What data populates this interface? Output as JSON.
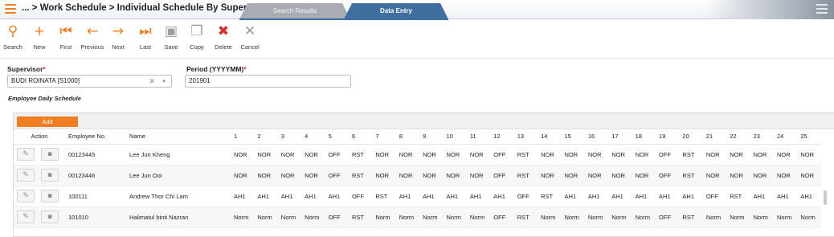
{
  "header": {
    "breadcrumb": "... > Work Schedule > Individual Schedule By Supervisor",
    "tabs": [
      {
        "label": "Search Results"
      },
      {
        "label": "Data Entry"
      }
    ]
  },
  "toolbar": [
    {
      "key": "search",
      "label": "Search",
      "glyph": "⚲",
      "icon": "search-icon",
      "tone": "orange"
    },
    {
      "key": "new",
      "label": "New",
      "glyph": "+",
      "icon": "plus-icon",
      "tone": "orange"
    },
    {
      "key": "first",
      "label": "First",
      "glyph": "⏮",
      "icon": "first-record-icon",
      "tone": "orange"
    },
    {
      "key": "previous",
      "label": "Previous",
      "glyph": "←",
      "icon": "arrow-left-icon",
      "tone": "orange"
    },
    {
      "key": "next",
      "label": "Next",
      "glyph": "→",
      "icon": "arrow-right-icon",
      "tone": "orange"
    },
    {
      "key": "last",
      "label": "Last",
      "glyph": "⏭",
      "icon": "last-record-icon",
      "tone": "orange"
    },
    {
      "key": "save",
      "label": "Save",
      "glyph": "▣",
      "icon": "save-icon",
      "tone": "gray"
    },
    {
      "key": "copy",
      "label": "Copy",
      "glyph": "❐",
      "icon": "copy-icon",
      "tone": "gray"
    },
    {
      "key": "delete",
      "label": "Delete",
      "glyph": "✖",
      "icon": "delete-icon",
      "tone": "red"
    },
    {
      "key": "cancel",
      "label": "Cancel",
      "glyph": "✕",
      "icon": "cancel-icon",
      "tone": "gray"
    }
  ],
  "form": {
    "supervisor": {
      "label": "Supervisor",
      "required_mark": "*",
      "value": "BUDI ROINATA [S1000]"
    },
    "period": {
      "label": "Period (YYYYMM)",
      "required_mark": "*",
      "value": "201901"
    }
  },
  "section_title": "Employee Daily Schedule",
  "grid": {
    "add_label": "Add",
    "columns": {
      "action": "Action",
      "employee_no": "Employee No.",
      "name": "Name",
      "days": [
        "1",
        "2",
        "3",
        "4",
        "5",
        "6",
        "7",
        "8",
        "9",
        "10",
        "11",
        "12",
        "13",
        "14",
        "15",
        "16",
        "17",
        "18",
        "19",
        "20",
        "21",
        "22",
        "23",
        "24",
        "25"
      ]
    },
    "rows": [
      {
        "employee_no": "00123445",
        "name": "Lee Jun Kheng",
        "days": [
          "NOR",
          "NOR",
          "NOR",
          "NOR",
          "OFF",
          "RST",
          "NOR",
          "NOR",
          "NOR",
          "NOR",
          "NOR",
          "OFF",
          "RST",
          "NOR",
          "NOR",
          "NOR",
          "NOR",
          "NOR",
          "OFF",
          "RST",
          "NOR",
          "NOR",
          "NOR",
          "NOR",
          "NOR"
        ]
      },
      {
        "employee_no": "00123446",
        "name": "Lee Jun Ooi",
        "days": [
          "NOR",
          "NOR",
          "NOR",
          "NOR",
          "OFF",
          "RST",
          "NOR",
          "NOR",
          "NOR",
          "NOR",
          "NOR",
          "OFF",
          "RST",
          "NOR",
          "NOR",
          "NOR",
          "NOR",
          "NOR",
          "OFF",
          "RST",
          "NOR",
          "NOR",
          "NOR",
          "NOR",
          "NOR"
        ]
      },
      {
        "employee_no": "100111",
        "name": "Andrew Thor Chi Lam",
        "days": [
          "AH1",
          "AH1",
          "AH1",
          "AH1",
          "AH1",
          "OFF",
          "RST",
          "AH1",
          "AH1",
          "AH1",
          "AH1",
          "AH1",
          "OFF",
          "RST",
          "AH1",
          "AH1",
          "AH1",
          "AH1",
          "AH1",
          "AH1",
          "OFF",
          "RST",
          "AH1",
          "AH1",
          "AH1"
        ]
      },
      {
        "employee_no": "101010",
        "name": "Halimatul binti Nazran",
        "days": [
          "Norm",
          "Norm",
          "Norm",
          "Norm",
          "OFF",
          "RST",
          "Norm",
          "Norm",
          "Norm",
          "Norm",
          "Norm",
          "OFF",
          "RST",
          "Norm",
          "Norm",
          "Norm",
          "Norm",
          "Norm",
          "OFF",
          "RST",
          "Norm",
          "Norm",
          "Norm",
          "Norm",
          "Norm"
        ]
      }
    ]
  }
}
